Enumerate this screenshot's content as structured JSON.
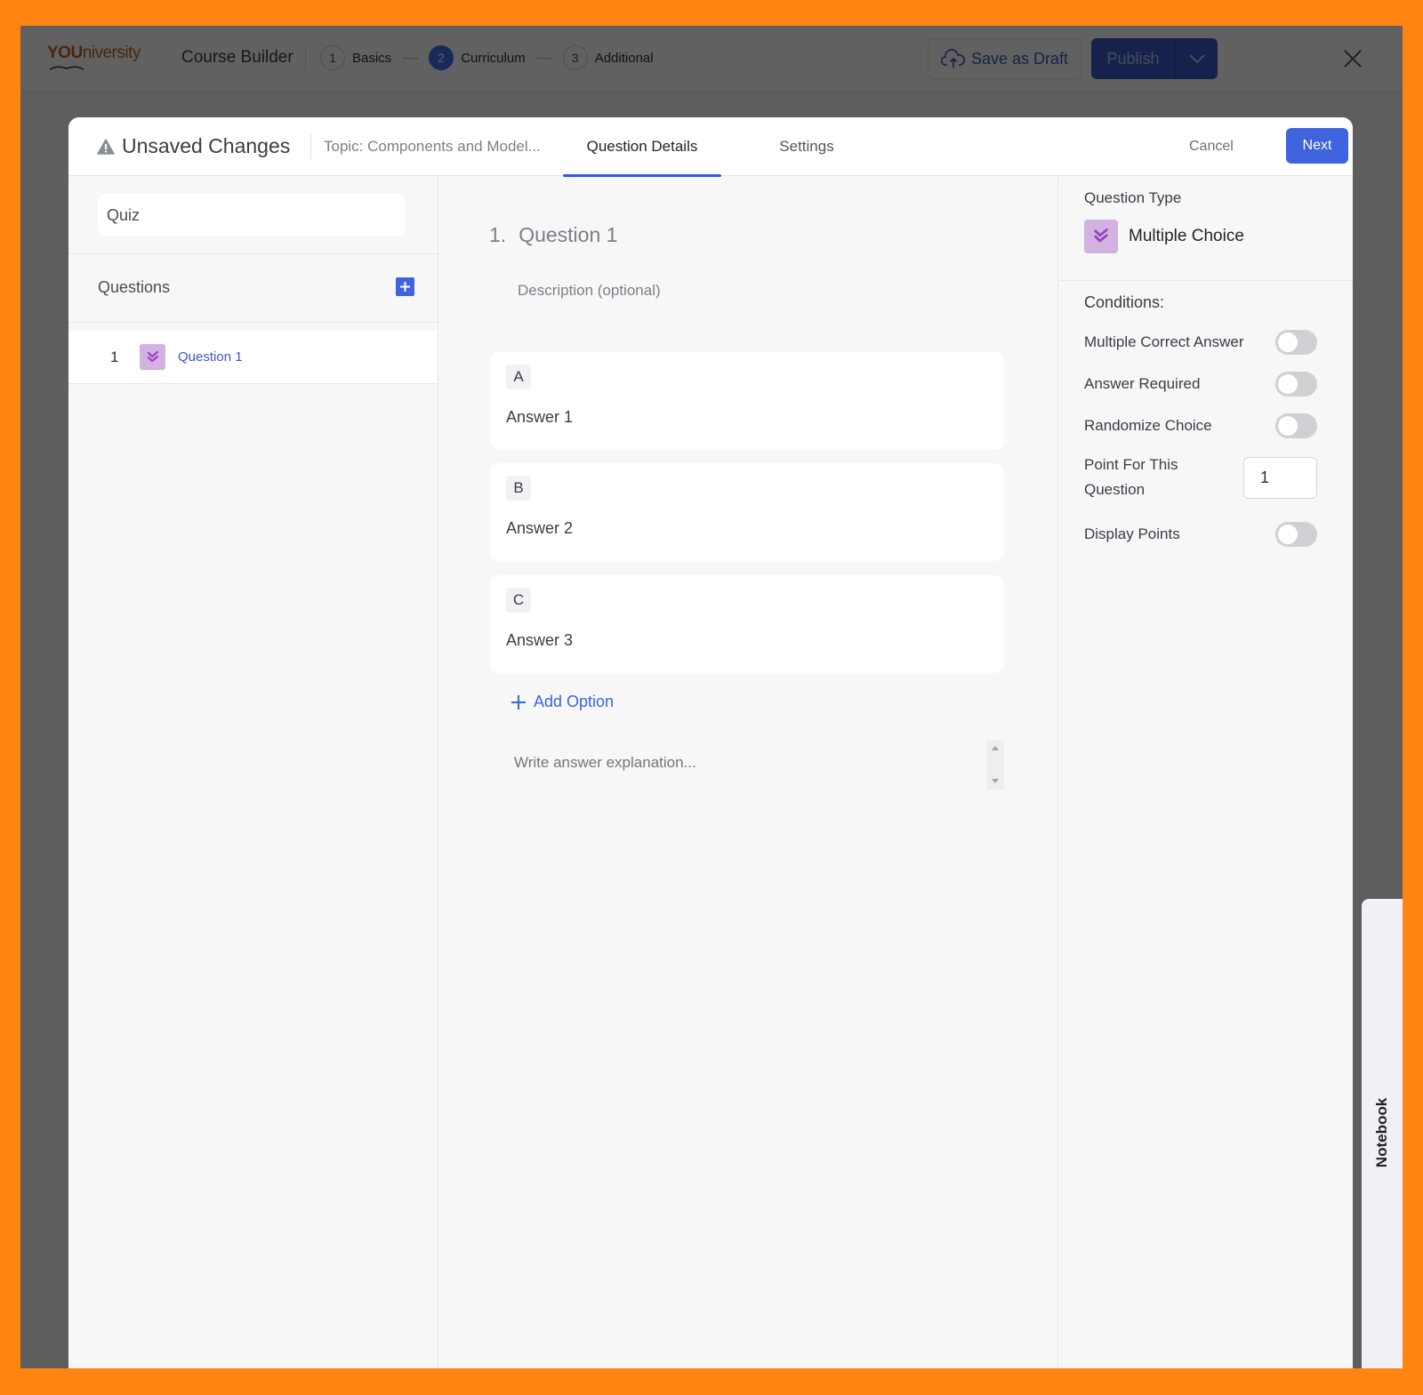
{
  "app": {
    "logo": {
      "part1": "YOU",
      "part2": "niversity"
    },
    "title": "Course Builder",
    "steps": [
      {
        "number": "1",
        "label": "Basics",
        "active": false
      },
      {
        "number": "2",
        "label": "Curriculum",
        "active": true
      },
      {
        "number": "3",
        "label": "Additional",
        "active": false
      }
    ],
    "save_draft_label": "Save as Draft",
    "publish_label": "Publish"
  },
  "modal": {
    "status": "Unsaved Changes",
    "topic": "Topic: Components and Model...",
    "tabs": [
      {
        "label": "Question Details",
        "active": true
      },
      {
        "label": "Settings",
        "active": false
      }
    ],
    "cancel_label": "Cancel",
    "next_label": "Next"
  },
  "left_panel": {
    "quiz_title_value": "Quiz",
    "questions_label": "Questions",
    "questions": [
      {
        "number": "1",
        "title": "Question 1",
        "type": "multiple-choice"
      }
    ]
  },
  "editor": {
    "question_number": "1.",
    "question_title": "Question 1",
    "description_placeholder": "Description (optional)",
    "answers": [
      {
        "letter": "A",
        "text": "Answer 1"
      },
      {
        "letter": "B",
        "text": "Answer 2"
      },
      {
        "letter": "C",
        "text": "Answer 3"
      }
    ],
    "add_option_label": "Add Option",
    "explanation_placeholder": "Write answer explanation..."
  },
  "settings_panel": {
    "question_type_label": "Question Type",
    "question_type_value": "Multiple Choice",
    "conditions_label": "Conditions:",
    "conditions": [
      {
        "label": "Multiple Correct Answer",
        "enabled": false
      },
      {
        "label": "Answer Required",
        "enabled": false
      },
      {
        "label": "Randomize Choice",
        "enabled": false
      }
    ],
    "points_label": "Point For This Question",
    "points_value": "1",
    "display_points_label": "Display Points",
    "display_points_enabled": false
  },
  "notebook_label": "Notebook",
  "colors": {
    "accent": "#3e63dd",
    "question_type_bg": "#d2b2e0",
    "question_type_fg": "#9b3fc0",
    "frame_border": "#ff8410"
  }
}
